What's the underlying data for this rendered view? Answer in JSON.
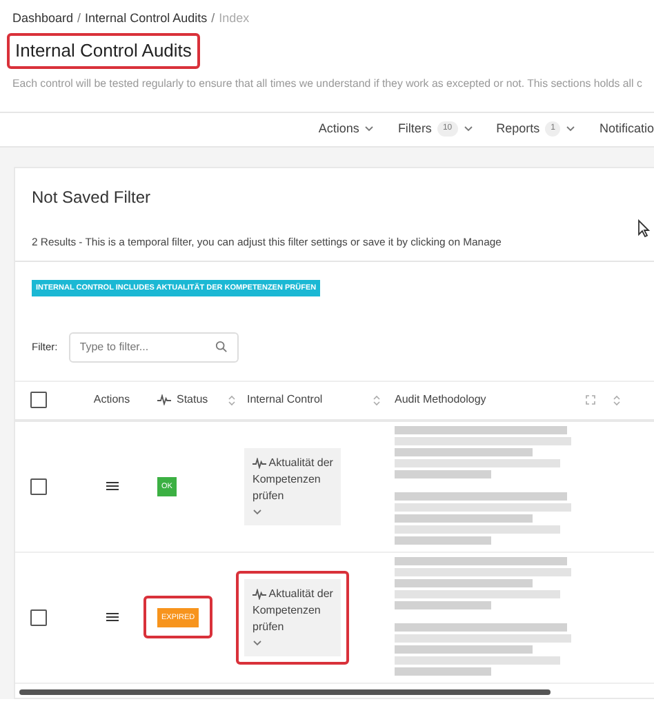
{
  "breadcrumb": [
    {
      "label": "Dashboard",
      "current": false,
      "separator": "/"
    },
    {
      "label": "Internal Control Audits",
      "current": false,
      "separator": "/"
    },
    {
      "label": "Index",
      "current": true
    }
  ],
  "title": {
    "text": "Internal Control Audits",
    "highlighted": true
  },
  "description": "Each control will be tested regularly to ensure that all times we understand if they work as excepted or not. This sections holds all c",
  "toolbar": [
    {
      "label": "Actions",
      "chevron": true
    },
    {
      "label": "Filters",
      "count": "10",
      "chevron": true
    },
    {
      "label": "Reports",
      "count": "1",
      "chevron": true
    },
    {
      "label": "Notificatio",
      "chevron": false
    }
  ],
  "card": {
    "title": "Not Saved Filter",
    "info": "2 Results - This is a temporal filter, you can adjust this filter settings or save it by clicking on Manage",
    "filter_tag": "INTERNAL CONTROL INCLUDES AKTUALITÄT DER KOMPETENZEN PRÜFEN",
    "filter": {
      "label": "Filter:",
      "placeholder": "Type to filter..."
    }
  },
  "table": {
    "columns": [
      {
        "kind": "checkbox",
        "checked": false
      },
      {
        "kind": "text",
        "label": "Actions"
      },
      {
        "kind": "status",
        "label": "Status",
        "sortable": true
      },
      {
        "kind": "text",
        "label": "Internal Control",
        "sortable": true
      },
      {
        "kind": "text",
        "label": "Audit Methodology",
        "extra": true
      }
    ],
    "rows": [
      {
        "checked": false,
        "status": {
          "label": "OK",
          "kind": "ok",
          "highlighted": false
        },
        "control": {
          "label": "Aktualität der Kompetenzen prüfen",
          "highlighted": false
        },
        "methodology": {
          "kind": "blurred"
        }
      },
      {
        "checked": false,
        "status": {
          "label": "EXPIRED",
          "kind": "expired",
          "highlighted": true
        },
        "control": {
          "label": "Aktualität der Kompetenzen prüfen",
          "highlighted": true
        },
        "methodology": {
          "kind": "blurred"
        }
      }
    ]
  }
}
